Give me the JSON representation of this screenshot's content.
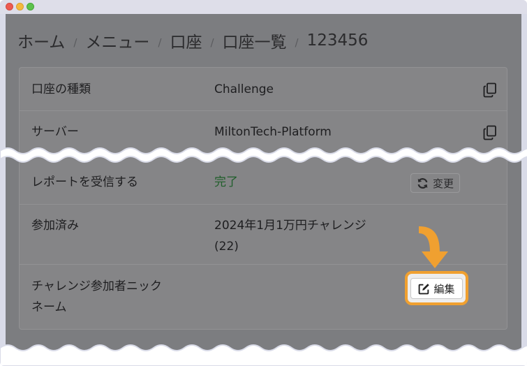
{
  "breadcrumb": {
    "items": [
      "ホーム",
      "メニュー",
      "口座",
      "口座一覧",
      "123456"
    ],
    "separator": "/"
  },
  "details": {
    "account_type": {
      "label": "口座の種類",
      "value": "Challenge"
    },
    "server": {
      "label": "サーバー",
      "value": "MiltonTech-Platform"
    },
    "report": {
      "label": "レポートを受信する",
      "value": "完了",
      "button": "変更"
    },
    "joined": {
      "label": "参加済み",
      "value_line1": "2024年1月1万円チャレンジ",
      "value_line2": "(22)"
    },
    "nickname": {
      "label_line1": "チャレンジ参加者ニック",
      "label_line2": "ネーム",
      "button": "編集"
    }
  },
  "colors": {
    "accent_highlight": "#f0a030",
    "status_ok": "#1f5e2a",
    "overlay": "#7c7d80"
  },
  "icons": {
    "copy": "copy-icon",
    "refresh": "refresh-icon",
    "edit": "edit-icon",
    "arrow": "arrow-down-icon"
  }
}
